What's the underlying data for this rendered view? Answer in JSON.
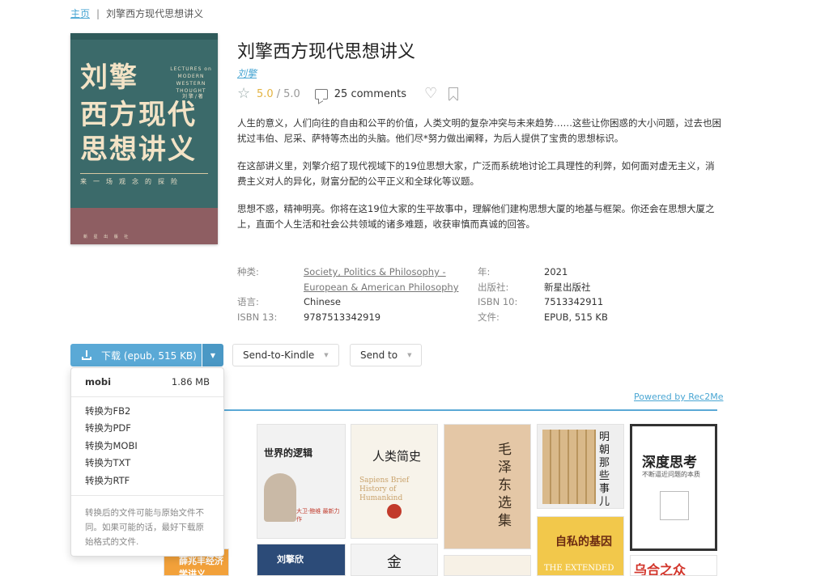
{
  "breadcrumb": {
    "home": "主页",
    "separator": "|",
    "current": "刘擎西方现代思想讲义"
  },
  "book": {
    "title": "刘擎西方现代思想讲义",
    "author": "刘擎",
    "rating": "5.0",
    "rating_max": "5.0",
    "comments": "25 comments",
    "description": [
      "人生的意义，人们向往的自由和公平的价值，人类文明的复杂冲突与未来趋势……这些让你困惑的大小问题，过去也困扰过韦伯、尼采、萨特等杰出的头脑。他们尽*努力做出阐释，为后人提供了宝贵的思想标识。",
      "在这部讲义里，刘擎介绍了现代视域下的19位思想大家，广泛而系统地讨论工具理性的利弊，如何面对虚无主义，消费主义对人的异化，财富分配的公平正义和全球化等议题。",
      "思想不惑，精神明亮。你将在这19位大家的生平故事中，理解他们建构思想大厦的地基与框架。你还会在思想大厦之上，直面个人生活和社会公共领域的诸多难题，收获审慎而真诚的回答。"
    ]
  },
  "cover": {
    "title_line1": "刘擎",
    "title_line2": "西方现代",
    "title_line3": "思想讲义",
    "english": "LECTURES on MODERN WESTERN THOUGHT",
    "author": "刘 擎 / 著",
    "subtitle": "来一场观念的探险",
    "publisher": "新 星 出 版 社"
  },
  "properties": {
    "category_label": "种类:",
    "category_value_1": "Society, Politics & Philosophy -",
    "category_value_2": "European & American Philosophy",
    "year_label": "年:",
    "year_value": "2021",
    "publisher_label": "出版社:",
    "publisher_value": "新星出版社",
    "language_label": "语言:",
    "language_value": "Chinese",
    "isbn10_label": "ISBN 10:",
    "isbn10_value": "7513342911",
    "isbn13_label": "ISBN 13:",
    "isbn13_value": "9787513342919",
    "file_label": "文件:",
    "file_value": "EPUB, 515 KB"
  },
  "actions": {
    "download_label": "下载 (epub, 515 KB)",
    "send_kindle_label": "Send-to-Kindle",
    "send_to_label": "Send to",
    "caret": "▼"
  },
  "dropdown": {
    "mobi_format": "mobi",
    "mobi_size": "1.86 MB",
    "conversions": [
      "转换为FB2",
      "转换为PDF",
      "转换为MOBI",
      "转换为TXT",
      "转换为RTF"
    ],
    "note": "转换后的文件可能与原始文件不同。如果可能的话，最好下载原始格式的文件."
  },
  "recommendations": {
    "powered_by": "Powered by Rec2Me",
    "items": [
      {
        "title": "世界的逻辑",
        "caption": "大卫·鲍维 最新力作"
      },
      {
        "title": "人类简史",
        "caption": "Sapiens Brief History of Humankind"
      },
      {
        "title": "毛泽东选集"
      },
      {
        "title": "明朝那些事儿"
      },
      {
        "title": "深度思考",
        "caption": "不断逼近问题的本质"
      },
      {
        "title": "自私的基因",
        "caption": "THE EXTENDED"
      },
      {
        "title": "薛兆丰经济学讲义"
      },
      {
        "title": "刘擎欣"
      },
      {
        "title": "金"
      },
      {
        "title": "乌合之众"
      }
    ]
  },
  "colors": {
    "accent": "#5aa9d6",
    "link": "#49a6d3",
    "star": "#e3b341",
    "cover_green": "#3b6a6a",
    "cover_band": "#8e5e62"
  }
}
